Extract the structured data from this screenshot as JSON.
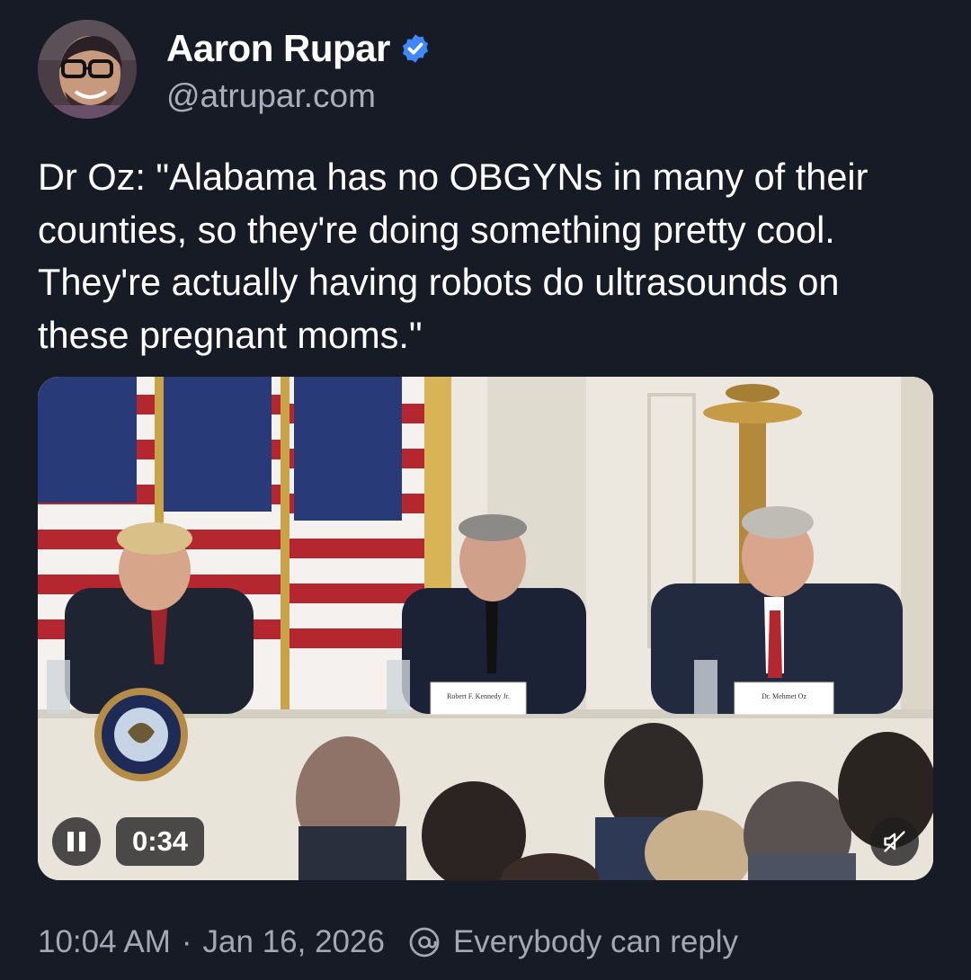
{
  "author": {
    "name": "Aaron Rupar",
    "handle": "@atrupar.com",
    "verified": true,
    "avatar_icon": "person-avatar-photo"
  },
  "post": {
    "text": "Dr Oz: \"Alabama has no OBGYNs in many of their counties, so they're doing something pretty cool. They're actually having robots do ultrasounds on these pregnant moms.\""
  },
  "video": {
    "elapsed": "0:34",
    "state": "playing",
    "muted": true,
    "placards": [
      "Robert F. Kennedy Jr.",
      "Dr. Mehmet Oz"
    ],
    "seal_text": "SEAL OF THE PRESIDENT OF THE UNITED STATES"
  },
  "meta": {
    "time": "10:04 AM",
    "separator": "·",
    "date": "Jan 16, 2026",
    "reply_setting": "Everybody can reply",
    "reply_icon": "at-sign-icon"
  },
  "colors": {
    "background": "#161b26",
    "verified_blue": "#3f87ff",
    "secondary_text": "#a3a9b4"
  }
}
